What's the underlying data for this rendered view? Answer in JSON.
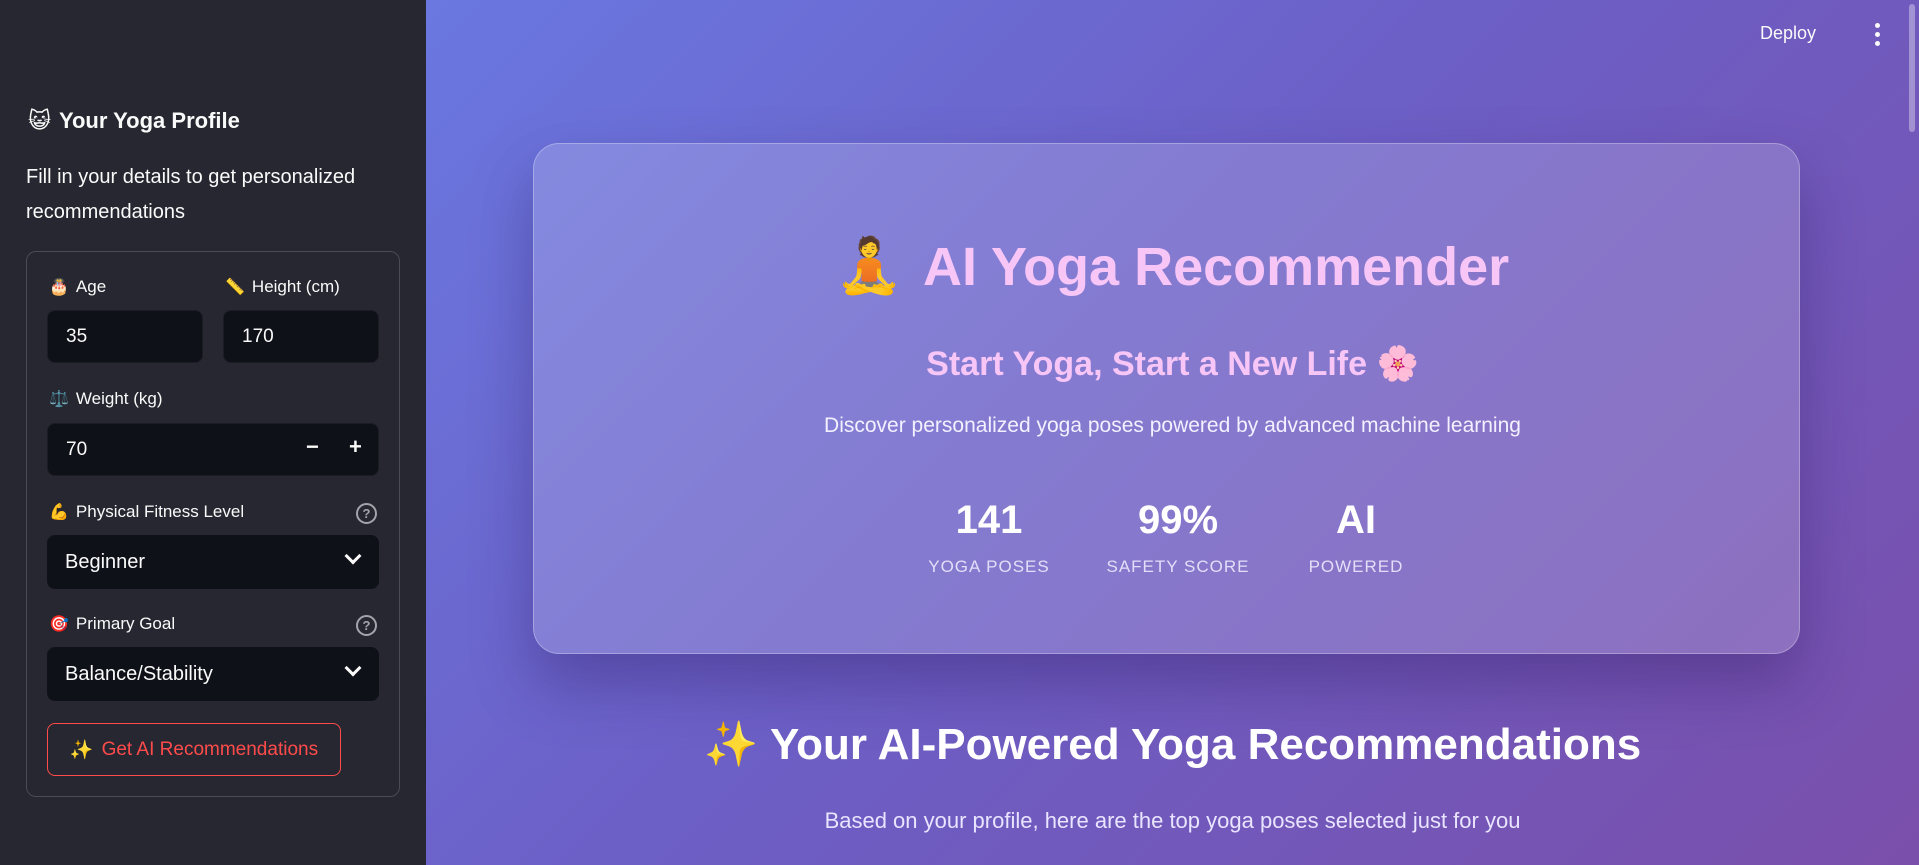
{
  "header": {
    "deploy_label": "Deploy"
  },
  "sidebar": {
    "title": "Your Yoga Profile",
    "title_emoji": "😺",
    "description": "Fill in your details to get personalized recommendations",
    "fields": {
      "age": {
        "emoji": "🎂",
        "label": "Age",
        "value": "35"
      },
      "height": {
        "emoji": "📏",
        "label": "Height (cm)",
        "value": "170"
      },
      "weight": {
        "emoji": "⚖️",
        "label": "Weight (kg)",
        "value": "70",
        "minus": "−",
        "plus": "+"
      },
      "fitness": {
        "emoji": "💪",
        "label": "Physical Fitness Level",
        "value": "Beginner"
      },
      "goal": {
        "emoji": "🎯",
        "label": "Primary Goal",
        "value": "Balance/Stability"
      }
    },
    "button": {
      "emoji": "✨",
      "label": "Get AI Recommendations"
    },
    "help_glyph": "?"
  },
  "hero": {
    "emoji": "🧘",
    "title": "AI Yoga Recommender",
    "subtitle": "Start Yoga, Start a New Life 🌸",
    "description": "Discover personalized yoga poses powered by advanced machine learning",
    "stats": [
      {
        "value": "141",
        "label": "YOGA POSES"
      },
      {
        "value": "99%",
        "label": "SAFETY SCORE"
      },
      {
        "value": "AI",
        "label": "POWERED"
      }
    ]
  },
  "recommendations": {
    "title": "✨ Your AI-Powered Yoga Recommendations",
    "description": "Based on your profile, here are the top yoga poses selected just for you"
  },
  "colors": {
    "sidebar_bg": "#262730",
    "input_bg": "#0e1117",
    "accent_red": "#ff4b4b",
    "hero_text": "#f7c6f7",
    "main_gradient_start": "#6a78e0",
    "main_gradient_end": "#7a4fab"
  }
}
